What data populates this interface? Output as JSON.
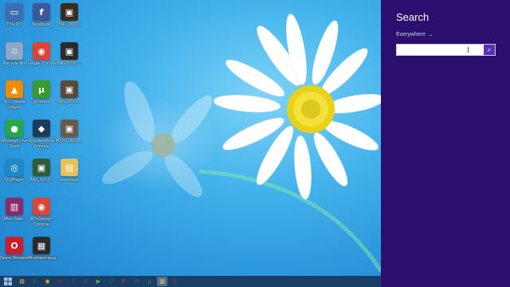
{
  "desktop": {
    "icons": [
      {
        "id": "this-pc",
        "label": "This PC",
        "glyph": "▭",
        "color": "#3d6fb0",
        "col": 0,
        "row": 0
      },
      {
        "id": "facebook",
        "label": "facebook",
        "glyph": "f",
        "color": "#3b5998",
        "col": 1,
        "row": 0
      },
      {
        "id": "dsc-photo",
        "label": "DSC_0021...",
        "glyph": "▣",
        "color": "#3a2a20",
        "col": 2,
        "row": 0
      },
      {
        "id": "recycle-bin",
        "label": "Recycle Bin",
        "glyph": "♲",
        "color": "#8fa7c4",
        "col": 0,
        "row": 1
      },
      {
        "id": "google-chrome",
        "label": "Google Chrome",
        "glyph": "◉",
        "color": "#db4437",
        "col": 1,
        "row": 1
      },
      {
        "id": "img-photo-1",
        "label": "IMG20181...",
        "glyph": "▣",
        "color": "#2a2a2a",
        "col": 2,
        "row": 1
      },
      {
        "id": "vlc",
        "label": "VLC media player",
        "glyph": "▲",
        "color": "#f08a00",
        "col": 0,
        "row": 2
      },
      {
        "id": "utorrent",
        "label": "µTorrent",
        "glyph": "µ",
        "color": "#3a9a2e",
        "col": 1,
        "row": 2
      },
      {
        "id": "img-photo-2",
        "label": "IMG_2012...",
        "glyph": "▣",
        "color": "#5a4a3a",
        "col": 2,
        "row": 2
      },
      {
        "id": "wlt",
        "label": "Windows Live Tools",
        "glyph": "●",
        "color": "#29a745",
        "col": 0,
        "row": 3
      },
      {
        "id": "wondershare",
        "label": "Wondershare Filmora",
        "glyph": "◆",
        "color": "#1b3b5a",
        "col": 1,
        "row": 3
      },
      {
        "id": "img-photo-3",
        "label": "MYXJ_2019...",
        "glyph": "▣",
        "color": "#6a5a4a",
        "col": 2,
        "row": 3
      },
      {
        "id": "qq-player",
        "label": "QQPlayer",
        "glyph": "◎",
        "color": "#1e88c8",
        "col": 0,
        "row": 4
      },
      {
        "id": "img-photo-4",
        "label": "IMG_0310...",
        "glyph": "▣",
        "color": "#2e5b3a",
        "col": 1,
        "row": 4
      },
      {
        "id": "download-folder",
        "label": "download",
        "glyph": "▤",
        "color": "#e8c15a",
        "col": 2,
        "row": 4
      },
      {
        "id": "winrar",
        "label": "Office.Stan...",
        "glyph": "▥",
        "color": "#8b2a6a",
        "col": 0,
        "row": 5
      },
      {
        "id": "mtu-chrome",
        "label": "MTuSetup - Chrome",
        "glyph": "◉",
        "color": "#db4437",
        "col": 1,
        "row": 5
      },
      {
        "id": "opera",
        "label": "Opera Browser",
        "glyph": "O",
        "color": "#cc1b2a",
        "col": 0,
        "row": 6
      },
      {
        "id": "screen-capture",
        "label": "Windowsmpeg",
        "glyph": "▦",
        "color": "#2a2a2a",
        "col": 1,
        "row": 6
      }
    ]
  },
  "charm": {
    "title": "Search",
    "scope": "Everywhere",
    "search_value": "",
    "search_placeholder": ""
  },
  "taskbar": {
    "items": [
      {
        "id": "file-explorer",
        "glyph": "▤",
        "color": "#f2c94c"
      },
      {
        "id": "excel",
        "glyph": "X",
        "color": "#1e7b45"
      },
      {
        "id": "chrome",
        "glyph": "◉",
        "color": "#f4b400"
      },
      {
        "id": "opera",
        "glyph": "O",
        "color": "#cc1b2a"
      },
      {
        "id": "facebook",
        "glyph": "f",
        "color": "#3b5998"
      },
      {
        "id": "excel-2",
        "glyph": "X",
        "color": "#1e7b45"
      },
      {
        "id": "media",
        "glyph": "▶",
        "color": "#6aa84f"
      },
      {
        "id": "outlook",
        "glyph": "O",
        "color": "#0b6bb8"
      },
      {
        "id": "powerpoint",
        "glyph": "P",
        "color": "#d24726"
      },
      {
        "id": "word",
        "glyph": "W",
        "color": "#2b579a"
      },
      {
        "id": "utorrent",
        "glyph": "µ",
        "color": "#3a9a2e"
      },
      {
        "id": "notes",
        "glyph": "▥",
        "color": "#f6e05e"
      },
      {
        "id": "capture",
        "glyph": "▦",
        "color": "#444444"
      }
    ],
    "active_index": 11
  }
}
